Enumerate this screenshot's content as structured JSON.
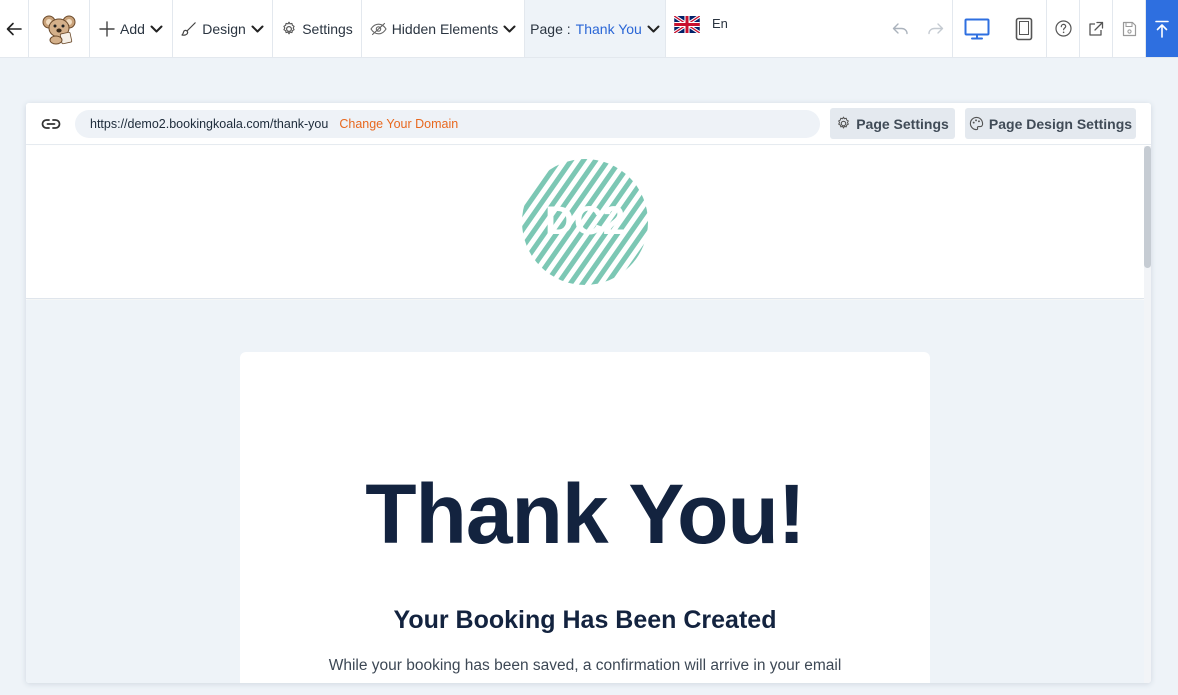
{
  "toolbar": {
    "add_label": "Add",
    "design_label": "Design",
    "settings_label": "Settings",
    "hidden_elements_label": "Hidden Elements",
    "page_prefix": "Page :",
    "page_value": "Thank You",
    "language_label": "En",
    "icons": [
      "back-arrow-icon",
      "koala-logo",
      "plus-icon",
      "brush-icon",
      "gear-icon",
      "eye-slash-icon",
      "uk-flag-icon",
      "undo-icon",
      "redo-icon",
      "desktop-icon",
      "tablet-icon",
      "help-icon",
      "external-link-icon",
      "save-icon",
      "scroll-top-icon"
    ],
    "accent_color": "#2e6fe0"
  },
  "urlbar": {
    "url": "https://demo2.bookingkoala.com/thank-you",
    "change_domain_label": "Change Your Domain",
    "page_settings_label": "Page Settings",
    "page_design_settings_label": "Page Design Settings"
  },
  "site": {
    "logo_text": "DC2",
    "logo_color": "#7cc7b4"
  },
  "content": {
    "title": "Thank You!",
    "subtitle": "Your Booking Has Been Created",
    "body": "While your booking has been saved, a confirmation will arrive in your email"
  }
}
